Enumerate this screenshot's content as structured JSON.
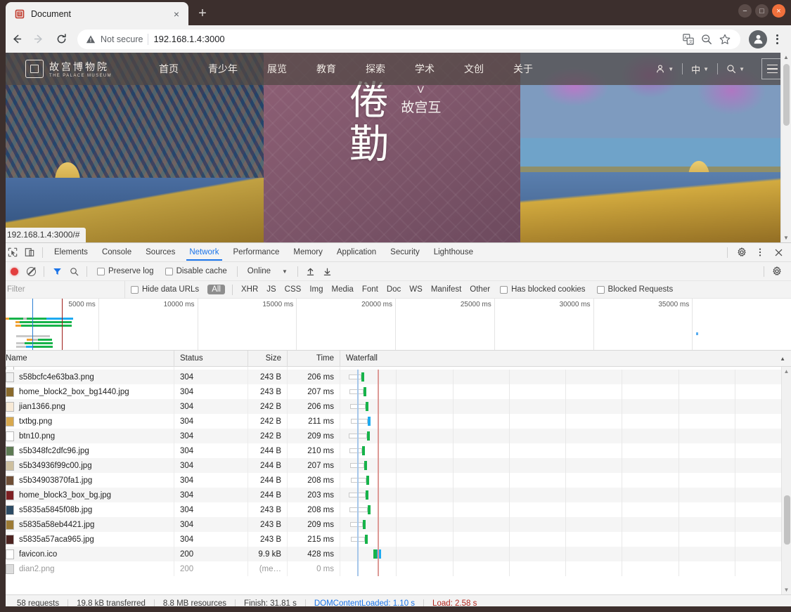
{
  "browser": {
    "tab": {
      "title": "Document",
      "favicon_icon": "palace-museum-favicon",
      "close_label": "×"
    },
    "new_tab_label": "+",
    "window_controls": {
      "minimize": "−",
      "maximize": "□",
      "close": "×"
    },
    "toolbar": {
      "back_label": "←",
      "forward_label": "→",
      "reload_label": "⟳",
      "security_label": "Not secure",
      "url": "192.168.1.4:3000",
      "icons": [
        "translate-icon",
        "zoom-out-icon",
        "bookmark-star-icon",
        "profile-avatar-icon",
        "chrome-menu-icon"
      ]
    }
  },
  "page": {
    "status_bubble": "192.168.1.4:3000/#",
    "site": {
      "logo_cn": "故宫博物院",
      "logo_en": "THE PALACE MUSEUM",
      "nav_items": [
        {
          "label": "首页"
        },
        {
          "label": "青少年"
        },
        {
          "label": "展览"
        },
        {
          "label": "教育"
        },
        {
          "label": "探索"
        },
        {
          "label": "学术"
        },
        {
          "label": "文创"
        },
        {
          "label": "关于"
        }
      ],
      "tools": [
        {
          "icon": "user-account-icon",
          "label": ""
        },
        {
          "icon": "language-icon",
          "label": "中"
        },
        {
          "icon": "search-icon",
          "label": ""
        }
      ],
      "menu_icon": "hamburger-menu-icon"
    },
    "hero": {
      "headline_chars": "倦勤",
      "side_v": "V",
      "side_chars": "故宫互"
    }
  },
  "devtools": {
    "tabs": [
      {
        "label": "Elements",
        "active": false
      },
      {
        "label": "Console",
        "active": false
      },
      {
        "label": "Sources",
        "active": false
      },
      {
        "label": "Network",
        "active": true
      },
      {
        "label": "Performance",
        "active": false
      },
      {
        "label": "Memory",
        "active": false
      },
      {
        "label": "Application",
        "active": false
      },
      {
        "label": "Security",
        "active": false
      },
      {
        "label": "Lighthouse",
        "active": false
      }
    ],
    "left_icons": [
      "inspect-element-icon",
      "device-toolbar-icon"
    ],
    "right_icons": [
      "settings-gear-icon",
      "more-options-icon",
      "close-devtools-icon"
    ],
    "toolbar": {
      "record_icon": "record-button-icon",
      "clear_icon": "clear-icon",
      "filter_icon": "filter-funnel-icon",
      "search_icon": "search-icon",
      "preserve_log_label": "Preserve log",
      "preserve_log_checked": false,
      "disable_cache_label": "Disable cache",
      "disable_cache_checked": false,
      "throttling_value": "Online",
      "import_icon": "import-har-icon",
      "export_icon": "export-har-icon",
      "settings_icon": "network-settings-gear-icon"
    },
    "filterbar": {
      "filter_placeholder": "Filter",
      "hide_data_urls_label": "Hide data URLs",
      "hide_data_urls_checked": false,
      "types": [
        "All",
        "XHR",
        "JS",
        "CSS",
        "Img",
        "Media",
        "Font",
        "Doc",
        "WS",
        "Manifest",
        "Other"
      ],
      "active_type": "All",
      "has_blocked_cookies_label": "Has blocked cookies",
      "has_blocked_cookies_checked": false,
      "blocked_requests_label": "Blocked Requests",
      "blocked_requests_checked": false
    },
    "overview": {
      "ticks": [
        "5000 ms",
        "10000 ms",
        "15000 ms",
        "20000 ms",
        "25000 ms",
        "30000 ms",
        "35000 ms"
      ],
      "dom_content_loaded_color": "#2a7fd4",
      "load_color": "#9e1a17"
    },
    "columns": [
      "Name",
      "Status",
      "Size",
      "Time",
      "Waterfall"
    ],
    "requests": [
      {
        "name": "s58bcfc4e63ba3.png",
        "status": "304",
        "size": "243 B",
        "time": "206 ms",
        "icon": "image-file-icon",
        "icon_color": "#f0f0f0"
      },
      {
        "name": "home_block2_box_bg1440.jpg",
        "status": "304",
        "size": "243 B",
        "time": "207 ms",
        "icon": "image-file-icon",
        "icon_color": "#8a6a2c"
      },
      {
        "name": "jian1366.png",
        "status": "304",
        "size": "242 B",
        "time": "206 ms",
        "icon": "image-file-icon",
        "icon_color": "#f7e9d6"
      },
      {
        "name": "txtbg.png",
        "status": "304",
        "size": "242 B",
        "time": "211 ms",
        "icon": "image-file-icon",
        "icon_color": "#d8a84e"
      },
      {
        "name": "btn10.png",
        "status": "304",
        "size": "242 B",
        "time": "209 ms",
        "icon": "image-file-icon",
        "icon_color": "#ffffff"
      },
      {
        "name": "s5b348fc2dfc96.jpg",
        "status": "304",
        "size": "244 B",
        "time": "210 ms",
        "icon": "image-file-icon",
        "icon_color": "#5e7a53"
      },
      {
        "name": "s5b34936f99c00.jpg",
        "status": "304",
        "size": "244 B",
        "time": "207 ms",
        "icon": "image-file-icon",
        "icon_color": "#cdbf9e"
      },
      {
        "name": "s5b34903870fa1.jpg",
        "status": "304",
        "size": "244 B",
        "time": "208 ms",
        "icon": "image-file-icon",
        "icon_color": "#6f4e36"
      },
      {
        "name": "home_block3_box_bg.jpg",
        "status": "304",
        "size": "244 B",
        "time": "203 ms",
        "icon": "image-file-icon",
        "icon_color": "#7d1f22"
      },
      {
        "name": "s5835a5845f08b.jpg",
        "status": "304",
        "size": "243 B",
        "time": "208 ms",
        "icon": "image-file-icon",
        "icon_color": "#2c4a63"
      },
      {
        "name": "s5835a58eb4421.jpg",
        "status": "304",
        "size": "243 B",
        "time": "209 ms",
        "icon": "image-file-icon",
        "icon_color": "#9c7a34"
      },
      {
        "name": "s5835a57aca965.jpg",
        "status": "304",
        "size": "243 B",
        "time": "215 ms",
        "icon": "image-file-icon",
        "icon_color": "#4d2320"
      },
      {
        "name": "favicon.ico",
        "status": "200",
        "size": "9.9 kB",
        "time": "428 ms",
        "icon": "image-file-icon",
        "icon_color": "#ffffff"
      },
      {
        "name": "dian2.png",
        "status": "200",
        "size": "(me…",
        "time": "0 ms",
        "icon": "image-file-icon",
        "icon_color": "#dcdcdc",
        "dim": true
      }
    ],
    "statusbar": {
      "requests": "58 requests",
      "transferred": "19.8 kB transferred",
      "resources": "8.8 MB resources",
      "finish": "Finish: 31.81 s",
      "dom_content_loaded": "DOMContentLoaded: 1.10 s",
      "load": "Load: 2.58 s"
    }
  }
}
